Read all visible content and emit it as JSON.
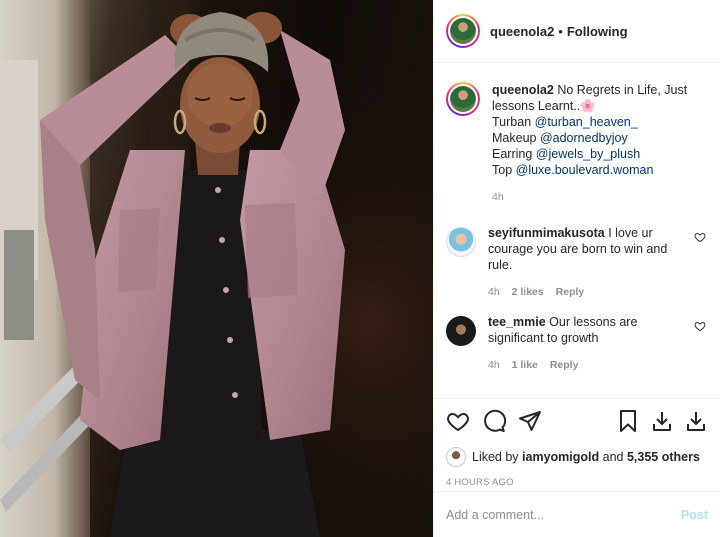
{
  "post": {
    "username": "queenola2",
    "separator": "•",
    "follow_status": "Following"
  },
  "caption": {
    "username": "queenola2",
    "line1": "No Regrets in Life, Just lessons Learnt..",
    "emoji": "🌸",
    "turban_label": "Turban ",
    "turban_handle": "@turban_heaven_",
    "makeup_label": "Makeup ",
    "makeup_handle": "@adornedbyjoy",
    "earring_label": "Earring ",
    "earring_handle": "@jewels_by_plush",
    "top_label": "Top ",
    "top_handle": "@luxe.boulevard.woman",
    "time": "4h"
  },
  "comments": [
    {
      "username": "seyifunmimakusota",
      "text": "I love ur courage you are born to win and rule.",
      "time": "4h",
      "likes": "2 likes",
      "reply": "Reply"
    },
    {
      "username": "tee_mmie",
      "text": "Our lessons are significant to growth",
      "time": "4h",
      "likes": "1 like",
      "reply": "Reply"
    }
  ],
  "likes": {
    "prefix": "Liked by ",
    "user": "iamyomigold",
    "middle": " and ",
    "others": "5,355 others"
  },
  "timestamp": "4 HOURS AGO",
  "add_comment": {
    "placeholder": "Add a comment...",
    "post_label": "Post"
  },
  "colors": {
    "link": "#00376b",
    "meta": "#8e8e8e",
    "post_disabled": "#b2dffc"
  },
  "icons": [
    "heart-icon",
    "comment-icon",
    "share-icon",
    "bookmark-icon",
    "download-icon",
    "download-icon"
  ]
}
